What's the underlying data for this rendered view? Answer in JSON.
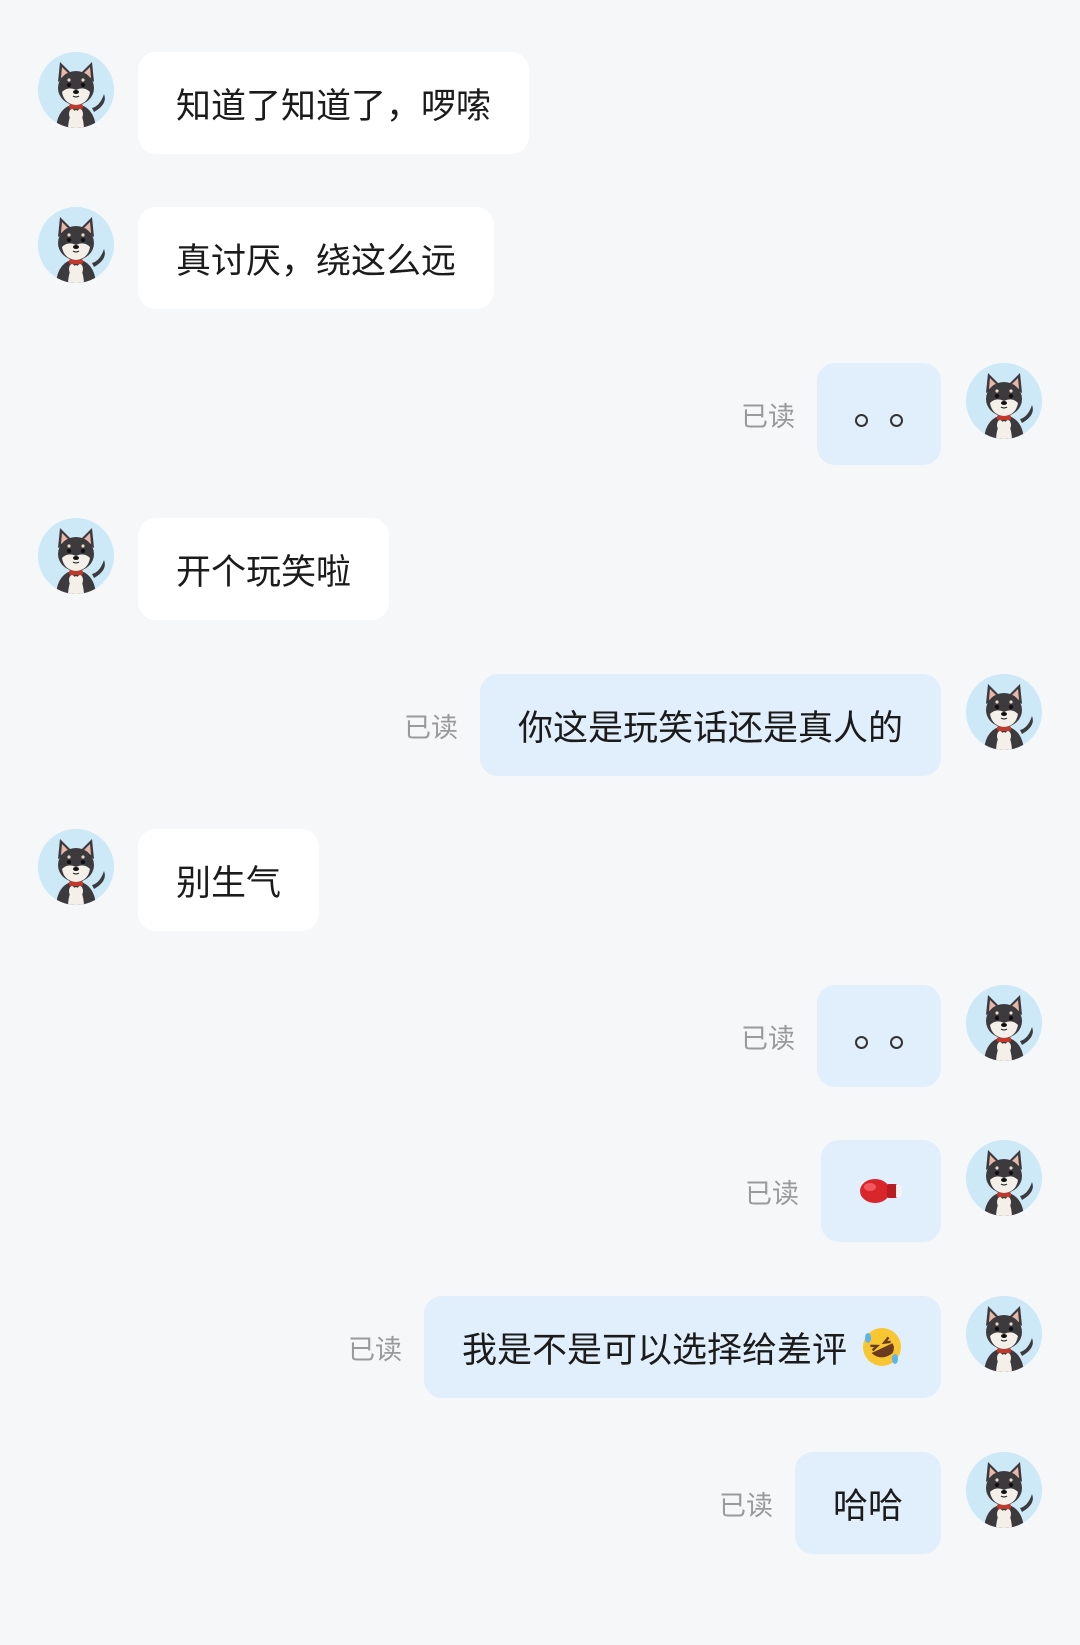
{
  "read_label": "已读",
  "messages": [
    {
      "side": "in",
      "text": "知道了知道了，啰嗦"
    },
    {
      "side": "in",
      "text": "真讨厌，绕这么远"
    },
    {
      "side": "out",
      "text": "。。",
      "read": "已读"
    },
    {
      "side": "in",
      "text": "开个玩笑啦"
    },
    {
      "side": "out",
      "text": "你这是玩笑话还是真人的",
      "read": "已读"
    },
    {
      "side": "in",
      "text": "别生气"
    },
    {
      "side": "out",
      "text": "。。",
      "read": "已读"
    },
    {
      "side": "out",
      "text": "",
      "emoji": "boxing-glove-icon",
      "read": "已读"
    },
    {
      "side": "out",
      "text": "我是不是可以选择给差评",
      "emoji": "rolling-on-floor-laughing-icon",
      "read": "已读"
    },
    {
      "side": "out",
      "text": "哈哈",
      "read": "已读"
    }
  ],
  "colors": {
    "background": "#f6f7f9",
    "incoming_bubble": "#ffffff",
    "outgoing_bubble": "#e1eefb",
    "avatar_bg": "#cde9f8",
    "read_text": "#9a9a9a"
  }
}
